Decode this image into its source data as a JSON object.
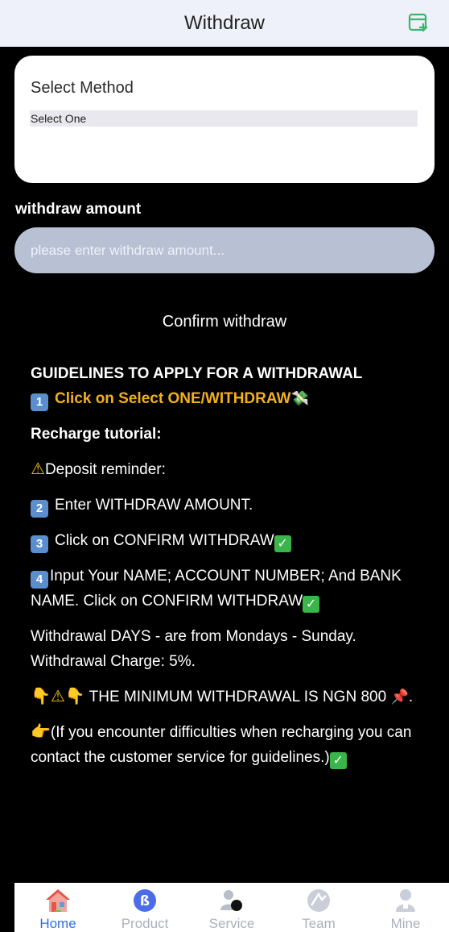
{
  "header": {
    "title": "Withdraw",
    "record_icon": "record-add-icon"
  },
  "method": {
    "label": "Select Method",
    "selected": "Select One"
  },
  "amount": {
    "label": "withdraw amount",
    "placeholder": "please enter withdraw amount..."
  },
  "confirm_label": "Confirm withdraw",
  "guidelines": {
    "title": "GUIDELINES TO APPLY FOR A WITHDRAWAL",
    "step1_num": "1",
    "step1": "Click on Select ONE/WITHDRAW",
    "tutorial": "Recharge tutorial:",
    "reminder": "Deposit reminder:",
    "step2_num": "2",
    "step2": "Enter WITHDRAW AMOUNT.",
    "step3_num": "3",
    "step3": "Click on CONFIRM WITHDRAW",
    "step4_num": "4",
    "step4": "Input Your NAME; ACCOUNT NUMBER; And BANK NAME. Click on CONFIRM WITHDRAW",
    "days": "Withdrawal DAYS - are from Mondays - Sunday.",
    "charge": "Withdrawal Charge: 5%.",
    "minimum": " THE MINIMUM WITHDRAWAL IS NGN 800",
    "minimum_tail": ".",
    "contact": "(If you encounter difficulties when recharging you can contact the customer service for guidelines.)"
  },
  "tabs": [
    {
      "label": "Home",
      "icon": "home-icon",
      "active": true
    },
    {
      "label": "Product",
      "icon": "product-icon",
      "active": false
    },
    {
      "label": "Service",
      "icon": "service-icon",
      "active": false
    },
    {
      "label": "Team",
      "icon": "team-icon",
      "active": false
    },
    {
      "label": "Mine",
      "icon": "mine-icon",
      "active": false
    }
  ],
  "colors": {
    "accent": "#2f6ee0",
    "highlight": "#f2b01e",
    "input_bg": "#b7c1d3",
    "header_bg": "#eef1fa"
  }
}
